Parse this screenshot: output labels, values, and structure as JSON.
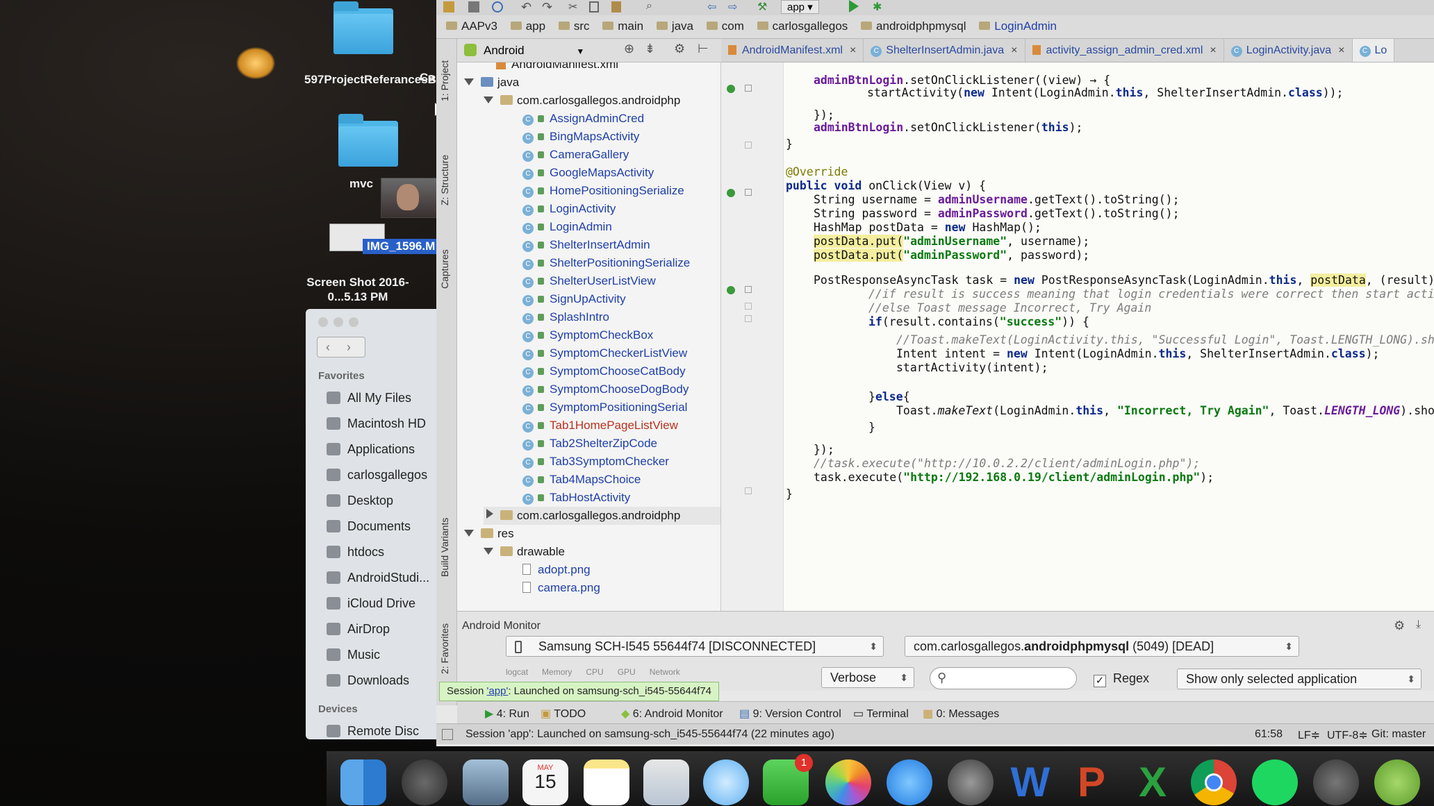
{
  "desktop": {
    "icons": [
      {
        "label": "597ProjectReferancesBryan"
      },
      {
        "label": "Ca"
      },
      {
        "label": "mvc"
      },
      {
        "label": "IMG_1596.M"
      },
      {
        "label": "Screen Shot 2016-0...5.13 PM"
      }
    ]
  },
  "finder": {
    "favorites_header": "Favorites",
    "favorites": [
      "All My Files",
      "Macintosh HD",
      "Applications",
      "carlosgallegos",
      "Desktop",
      "Documents",
      "htdocs",
      "AndroidStudi...",
      "iCloud Drive",
      "AirDrop",
      "Music",
      "Downloads"
    ],
    "devices_header": "Devices",
    "devices": [
      "Remote Disc"
    ]
  },
  "ide": {
    "toolbar_run_config": "app",
    "breadcrumbs": [
      "AAPv3",
      "app",
      "src",
      "main",
      "java",
      "com",
      "carlosgallegos",
      "androidphpmysql",
      "LoginAdmin"
    ],
    "project_view": "Android",
    "side_tabs": [
      "1: Project",
      "Z: Structure",
      "Captures",
      "Build Variants",
      "2: Favorites"
    ],
    "tree": {
      "manifest": "AndroidManifest.xml",
      "java": "java",
      "package1": "com.carlosgallegos.androidphp",
      "classes": [
        "AssignAdminCred",
        "BingMapsActivity",
        "CameraGallery",
        "GoogleMapsActivity",
        "HomePositioningSerialize",
        "LoginActivity",
        "LoginAdmin",
        "ShelterInsertAdmin",
        "ShelterPositioningSerialize",
        "ShelterUserListView",
        "SignUpActivity",
        "SplashIntro",
        "SymptomCheckBox",
        "SymptomCheckerListView",
        "SymptomChooseCatBody",
        "SymptomChooseDogBody",
        "SymptomPositioningSerial",
        "Tab1HomePageListView",
        "Tab2ShelterZipCode",
        "Tab3SymptomChecker",
        "Tab4MapsChoice",
        "TabHostActivity"
      ],
      "package2": "com.carlosgallegos.androidphp",
      "res": "res",
      "drawable": "drawable",
      "drawables": [
        "adopt.png",
        "camera.png"
      ]
    },
    "tabs": [
      "AndroidManifest.xml",
      "ShelterInsertAdmin.java",
      "activity_assign_admin_cred.xml",
      "LoginActivity.java",
      "Lo"
    ],
    "code": {
      "l1a": "adminBtnLogin",
      "l1b": ".setOnClickListener((view) → {",
      "l2a": "startActivity(",
      "l2b": "new",
      "l2c": " Intent(LoginAdmin.",
      "l2d": "this",
      "l2e": ", ShelterInsertAdmin.",
      "l2f": "class",
      "l2g": "));",
      "l3": "});",
      "l4a": "adminBtnLogin",
      "l4b": ".setOnClickListener(",
      "l4c": "this",
      "l4d": ");",
      "l5": "}",
      "l6": "@Override",
      "l7a": "public void",
      "l7b": " onClick(View v) {",
      "l8a": "String username = ",
      "l8b": "adminUsername",
      "l8c": ".getText().toString();",
      "l9a": "String password = ",
      "l9b": "adminPassword",
      "l9c": ".getText().toString();",
      "l10a": "HashMap postData = ",
      "l10b": "new",
      "l10c": " HashMap();",
      "l11a": "postData.put(",
      "l11b": "\"adminUsername\"",
      "l11c": ", username);",
      "l12a": "postData.put(",
      "l12b": "\"adminPassword\"",
      "l12c": ", password);",
      "l13a": "PostResponseAsyncTask task = ",
      "l13b": "new",
      "l13c": " PostResponseAsyncTask(LoginAdmin.",
      "l13d": "this",
      "l13e": ", ",
      "l13f": "postData",
      "l13g": ", (result) →",
      "l14": "//if result is success meaning that login credentials were correct then start activity",
      "l15": "//else Toast message Incorrect, Try Again",
      "l16a": "if",
      "l16b": "(result.contains(",
      "l16c": "\"success\"",
      "l16d": ")) {",
      "l17": "//Toast.makeText(LoginActivity.this, \"Successful Login\", Toast.LENGTH_LONG).show(",
      "l18a": "Intent intent = ",
      "l18b": "new",
      "l18c": " Intent(LoginAdmin.",
      "l18d": "this",
      "l18e": ", ShelterInsertAdmin.",
      "l18f": "class",
      "l18g": ");",
      "l19": "startActivity(intent);",
      "l20a": "}",
      "l20b": "else",
      "l20c": "{",
      "l21a": "Toast.",
      "l21b": "makeText",
      "l21c": "(LoginAdmin.",
      "l21d": "this",
      "l21e": ", ",
      "l21f": "\"Incorrect, Try Again\"",
      "l21g": ", Toast.",
      "l21h": "LENGTH_LONG",
      "l21i": ").show(",
      "l22": "}",
      "l23": "});",
      "l24": "//task.execute(\"http://10.0.2.2/client/adminLogin.php\");",
      "l25a": "task.execute(",
      "l25b": "\"http://192.168.0.19/client/adminLogin.php\"",
      "l25c": ");",
      "l26": "}",
      "l27": "}"
    },
    "monitor": {
      "title": "Android Monitor",
      "device": "Samsung SCH-I545 55644f74 [DISCONNECTED]",
      "process_prefix": "com.carlosgallegos.",
      "process_bold": "androidphpmysql",
      "process_suffix": " (5049) [DEAD]",
      "subtabs": [
        "logcat",
        "Memory",
        "CPU",
        "GPU",
        "Network"
      ],
      "level": "Verbose",
      "search_placeholder": "",
      "regex_label": "Regex",
      "filter": "Show only selected application"
    },
    "tooltip": {
      "prefix": "Session ",
      "link": "'app'",
      "suffix": ": Launched on samsung-sch_i545-55644f74"
    },
    "runbar": [
      "4: Run",
      "TODO",
      "6: Android Monitor",
      "9: Version Control",
      "Terminal",
      "0: Messages"
    ],
    "status": {
      "message": "Session 'app': Launched on samsung-sch_i545-55644f74 (22 minutes ago)",
      "position": "61:58",
      "line_sep": "LF≑",
      "encoding": "UTF-8≑",
      "vcs": "Git: master"
    }
  },
  "dock": {
    "calendar_month": "MAY",
    "calendar_day": "15",
    "facetime_badge": "1"
  }
}
